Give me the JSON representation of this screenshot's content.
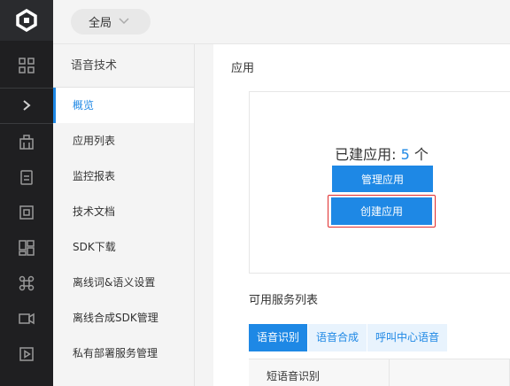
{
  "rail": {
    "icons": [
      "logo-icon",
      "grid-icon",
      "chevron-right-icon",
      "building-icon",
      "clipboard-icon",
      "frame-icon",
      "dashboard-icon",
      "command-icon",
      "video-icon",
      "play-icon"
    ]
  },
  "topbar": {
    "scope_label": "全局"
  },
  "subnav": {
    "title": "语音技术",
    "items": [
      {
        "label": "概览"
      },
      {
        "label": "应用列表"
      },
      {
        "label": "监控报表"
      },
      {
        "label": "技术文档"
      },
      {
        "label": "SDK下载"
      },
      {
        "label": "离线词&语义设置"
      },
      {
        "label": "离线合成SDK管理"
      },
      {
        "label": "私有部署服务管理"
      }
    ]
  },
  "main": {
    "section_title": "应用",
    "created_prefix": "已建应用:",
    "created_count": "5",
    "created_unit": "个",
    "manage_button": "管理应用",
    "create_button": "创建应用",
    "services_title": "可用服务列表",
    "tabs": [
      "语音识别",
      "语音合成",
      "呼叫中心语音"
    ],
    "table_first_cell": "短语音识别"
  },
  "colors": {
    "accent": "#1e88e5",
    "highlight_border": "#e02d2d",
    "rail_bg": "#1f1f21"
  }
}
